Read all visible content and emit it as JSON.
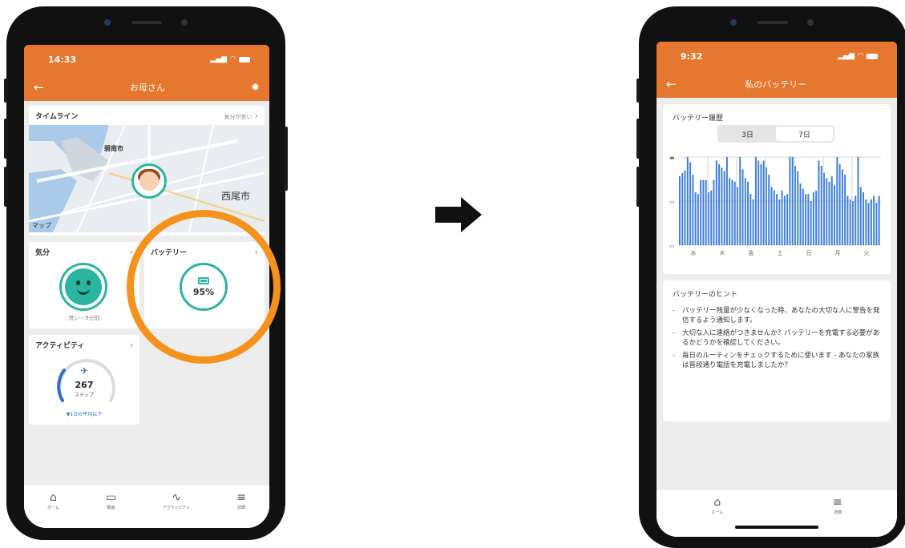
{
  "left_phone": {
    "status": {
      "time": "14:33"
    },
    "appbar": {
      "title": "お母さん"
    },
    "timeline": {
      "title": "タイムライン",
      "status_link": "気分が良い"
    },
    "map": {
      "city_large": "西尾市",
      "city_small": "碧南市",
      "attribution": "マップ"
    },
    "mood": {
      "title": "気分",
      "caption": "良い・9分前"
    },
    "battery": {
      "title": "バッテリー",
      "percent": "95%",
      "level": 0.95
    },
    "activity": {
      "title": "アクティビティ",
      "steps": "267",
      "unit": "ステップ",
      "caption": "▼1日の平均以下"
    },
    "tabs": [
      "ホーム",
      "動画",
      "アクティビティ",
      "詳細"
    ]
  },
  "right_phone": {
    "status": {
      "time": "9:32"
    },
    "appbar": {
      "title": "私のバッテリー"
    },
    "history": {
      "title": "バッテリー履歴",
      "segments": [
        "3日",
        "7日"
      ],
      "selected_segment": "7日"
    },
    "hints": {
      "title": "バッテリーのヒント",
      "items": [
        "バッテリー残量が少なくなった時、あなたの大切な人に警告を発信するよう通知します。",
        "大切な人に連絡がつきませんか？バッテリーを充電する必要があるかどうかを確認してください。",
        "毎日のルーティンをチェックするために使います - あなたの家族は普段通り電話を充電しましたか？"
      ]
    },
    "tabs": [
      "ホーム",
      "詳細"
    ]
  },
  "colors": {
    "header": "#e6772e",
    "teal": "#2bb5a0",
    "highlight_ring": "#f4921b",
    "bar": "#3d7fd9"
  },
  "chart_data": {
    "type": "bar",
    "title": "バッテリー履歴",
    "x_ticks": [
      "水",
      "木",
      "金",
      "土",
      "日",
      "月",
      "火"
    ],
    "y_ticks": [
      "▬",
      "▭",
      "▭"
    ],
    "ylim": [
      0,
      100
    ],
    "values": [
      78,
      82,
      85,
      100,
      94,
      80,
      60,
      58,
      74,
      74,
      74,
      60,
      62,
      74,
      96,
      92,
      88,
      84,
      100,
      76,
      74,
      72,
      66,
      100,
      86,
      76,
      72,
      58,
      52,
      100,
      96,
      92,
      96,
      88,
      80,
      66,
      62,
      58,
      52,
      62,
      56,
      58,
      100,
      100,
      90,
      84,
      70,
      64,
      58,
      58,
      50,
      60,
      62,
      96,
      90,
      82,
      76,
      72,
      78,
      68,
      100,
      92,
      86,
      80,
      56,
      52,
      50,
      56,
      100,
      66,
      60,
      52,
      48,
      52,
      56,
      48,
      56
    ]
  }
}
